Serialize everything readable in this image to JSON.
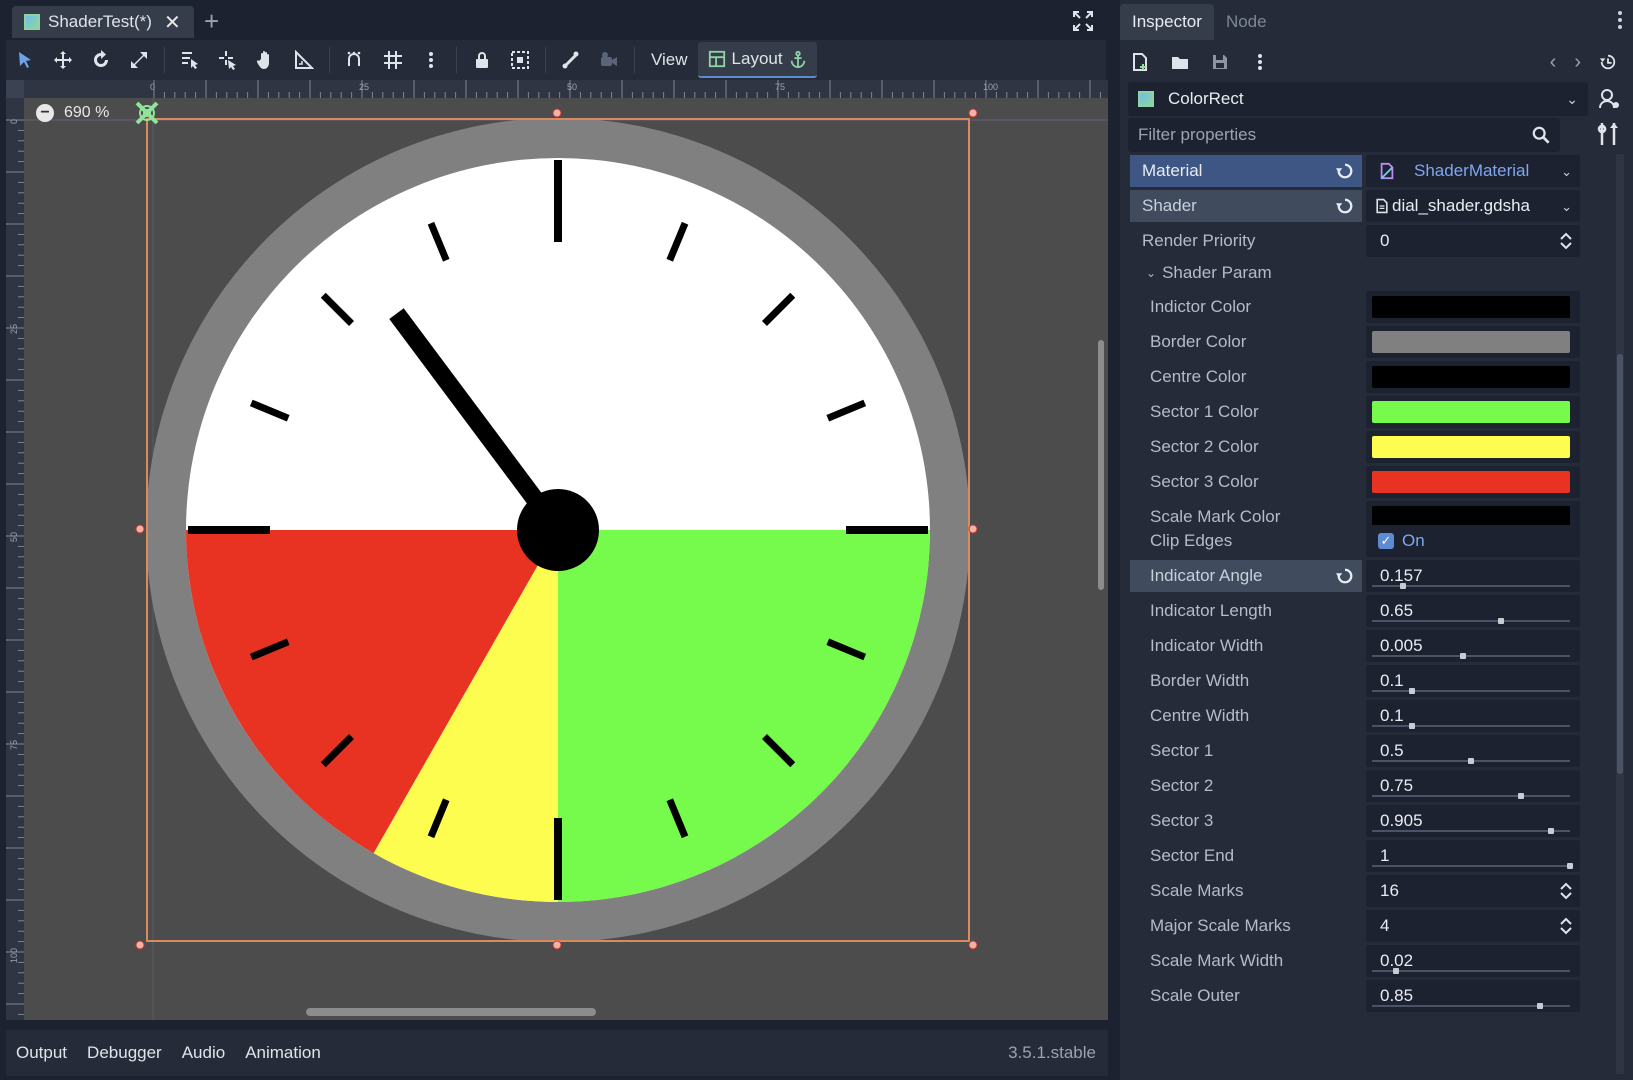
{
  "editor": {
    "scene_tab": "ShaderTest(*)",
    "close_symbol": "✕",
    "add_tab_symbol": "+",
    "toolbar": {
      "view_label": "View",
      "layout_label": "Layout"
    },
    "zoom_label": "690 %",
    "ruler_top_ticks": [
      "0",
      "25",
      "50",
      "75",
      "100"
    ],
    "ruler_left_ticks": [
      "0",
      "25",
      "50",
      "75",
      "100"
    ],
    "bottom_tabs": [
      "Output",
      "Debugger",
      "Audio",
      "Animation"
    ],
    "version": "3.5.1.stable"
  },
  "inspector": {
    "tabs": [
      "Inspector",
      "Node"
    ],
    "object_name": "ColorRect",
    "filter_placeholder": "Filter properties",
    "material_label": "Material",
    "material_value": "ShaderMaterial",
    "shader_label": "Shader",
    "shader_value": "dial_shader.gdsha",
    "render_priority_label": "Render Priority",
    "render_priority_value": "0",
    "section_label": "Shader Param",
    "colors": [
      {
        "label": "Indictor Color",
        "hex": "#000000"
      },
      {
        "label": "Border Color",
        "hex": "#808080"
      },
      {
        "label": "Centre Color",
        "hex": "#000000"
      },
      {
        "label": "Sector 1 Color",
        "hex": "#76fa4b"
      },
      {
        "label": "Sector 2 Color",
        "hex": "#fdfd50"
      },
      {
        "label": "Sector 3 Color",
        "hex": "#e83323"
      },
      {
        "label": "Scale Mark Color",
        "hex": "#000000"
      }
    ],
    "clip_edges_label": "Clip Edges",
    "clip_edges_value": "On",
    "sliders": [
      {
        "label": "Indicator Angle",
        "value": "0.157",
        "fraction": 0.157,
        "highlight": true
      },
      {
        "label": "Indicator Length",
        "value": "0.65",
        "fraction": 0.65
      },
      {
        "label": "Indicator Width",
        "value": "0.005",
        "fraction": 0.46
      },
      {
        "label": "Border Width",
        "value": "0.1",
        "fraction": 0.2
      },
      {
        "label": "Centre Width",
        "value": "0.1",
        "fraction": 0.2
      },
      {
        "label": "Sector 1",
        "value": "0.5",
        "fraction": 0.5
      },
      {
        "label": "Sector 2",
        "value": "0.75",
        "fraction": 0.75
      },
      {
        "label": "Sector 3",
        "value": "0.905",
        "fraction": 0.905
      },
      {
        "label": "Sector End",
        "value": "1",
        "fraction": 1.0
      }
    ],
    "scale_marks_label": "Scale Marks",
    "scale_marks_value": "16",
    "major_scale_marks_label": "Major Scale Marks",
    "major_scale_marks_value": "4",
    "scale_sliders": [
      {
        "label": "Scale Mark Width",
        "value": "0.02",
        "fraction": 0.12
      },
      {
        "label": "Scale Outer",
        "value": "0.85",
        "fraction": 0.85
      }
    ]
  },
  "dial": {
    "border_color": "#808080",
    "face_color": "#ffffff",
    "sector1_color": "#76fa4b",
    "sector2_color": "#fdfd50",
    "sector3_color": "#e83323",
    "indicator_color": "#000000",
    "sector_1": 0.5,
    "sector_2": 0.75,
    "sector_3": 0.905,
    "indicator_angle": 0.157,
    "scale_marks": 16,
    "major_scale_marks": 4
  }
}
